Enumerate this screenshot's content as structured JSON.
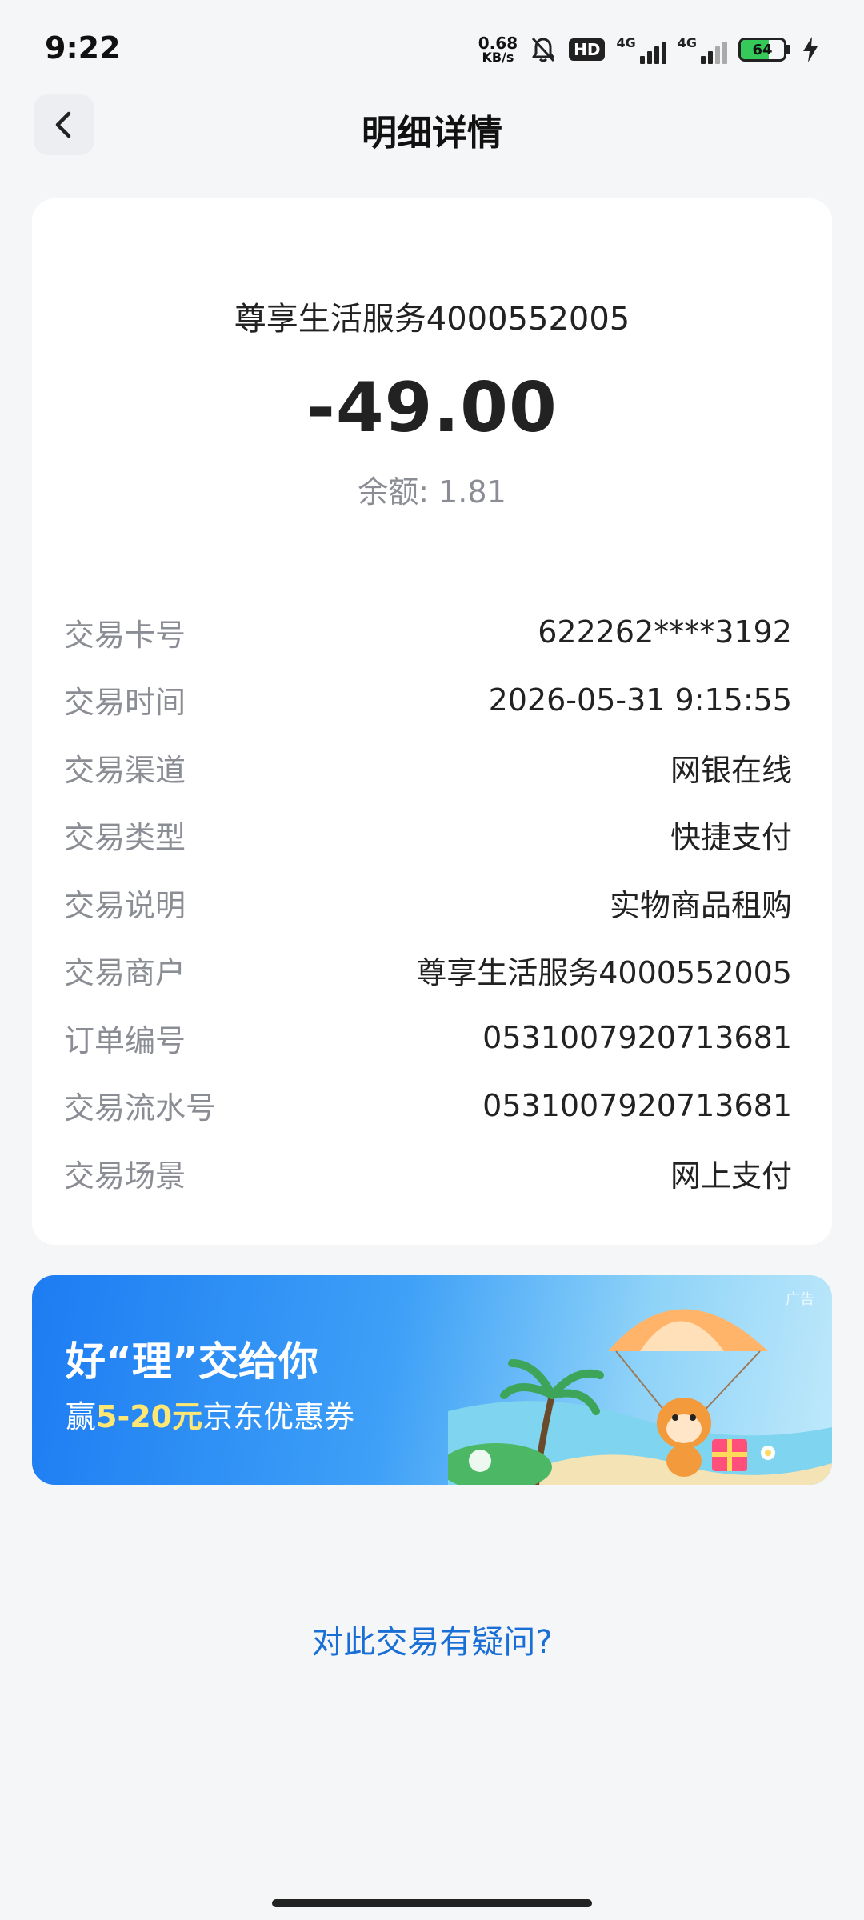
{
  "status_bar": {
    "time": "9:22",
    "net_speed_value": "0.68",
    "net_speed_unit": "KB/s",
    "hd_label": "HD",
    "signal_1_label": "4G",
    "signal_2_label": "4G",
    "battery_percent": "64",
    "battery_level": 0.64,
    "icons": [
      "mute-bell-icon",
      "hd-voice-icon",
      "signal-icon",
      "signal-icon",
      "battery-icon",
      "charging-icon"
    ]
  },
  "header": {
    "back_icon": "chevron-left-icon",
    "title": "明细详情"
  },
  "summary": {
    "merchant": "尊享生活服务4000552005",
    "amount": "-49.00",
    "balance": "余额: 1.81"
  },
  "details": [
    {
      "label": "交易卡号",
      "value": "622262****3192"
    },
    {
      "label": "交易时间",
      "value": "2026-05-31 9:15:55"
    },
    {
      "label": "交易渠道",
      "value": "网银在线"
    },
    {
      "label": "交易类型",
      "value": "快捷支付"
    },
    {
      "label": "交易说明",
      "value": "实物商品租购"
    },
    {
      "label": "交易商户",
      "value": "尊享生活服务4000552005"
    },
    {
      "label": "订单编号",
      "value": "0531007920713681"
    },
    {
      "label": "交易流水号",
      "value": "0531007920713681"
    },
    {
      "label": "交易场景",
      "value": "网上支付"
    }
  ],
  "banner": {
    "headline": "好“理”交给你",
    "sub_prefix": "赢",
    "sub_highlight": "5-20元",
    "sub_suffix": "京东优惠券",
    "ad_tag": "广告",
    "colors": {
      "start": "#1d7cf2",
      "end": "#bfe9fb",
      "highlight": "#ffe774"
    }
  },
  "help_link": "对此交易有疑问?",
  "colors": {
    "background": "#f5f6f8",
    "card": "#ffffff",
    "label": "#8a8d93",
    "link": "#1a6fd6"
  }
}
